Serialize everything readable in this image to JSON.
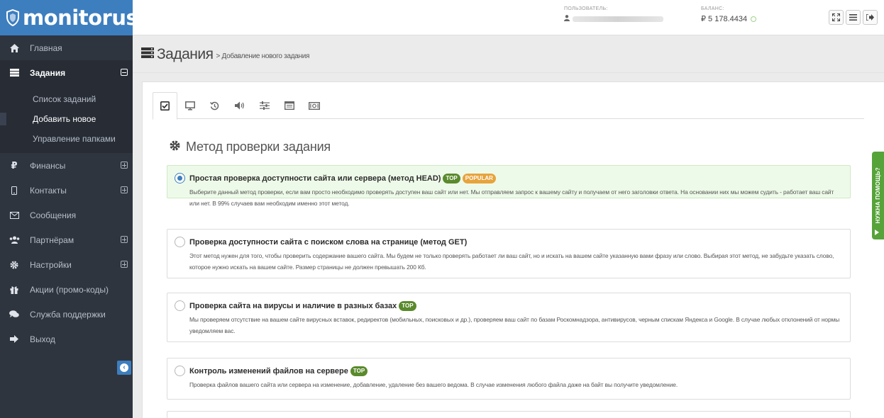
{
  "app": {
    "logo_text": "monitorus"
  },
  "sidebar": {
    "items": [
      {
        "label": "Главная",
        "icon": "home-icon"
      },
      {
        "label": "Задания",
        "icon": "tasks-icon"
      },
      {
        "label": "Финансы",
        "icon": "ruble-icon"
      },
      {
        "label": "Контакты",
        "icon": "phone-icon"
      },
      {
        "label": "Сообщения",
        "icon": "envelope-icon"
      },
      {
        "label": "Партнёрам",
        "icon": "users-icon"
      },
      {
        "label": "Настройки",
        "icon": "gear-icon"
      },
      {
        "label": "Акции (промо-коды)",
        "icon": "gift-icon"
      },
      {
        "label": "Служба поддержки",
        "icon": "comments-icon"
      },
      {
        "label": "Выход",
        "icon": "sign-out-icon"
      }
    ],
    "tasks_sub": [
      {
        "label": "Список заданий"
      },
      {
        "label": "Добавить новое"
      },
      {
        "label": "Управление папками"
      }
    ]
  },
  "header": {
    "user_label": "ПОЛЬЗОВАТЕЛЬ:",
    "balance_label": "БАЛАНС:",
    "balance_value": "₽ 5 178.4434"
  },
  "page": {
    "title": "Задания",
    "breadcrumb": "> Добавление нового задания"
  },
  "tabs": [
    {
      "icon": "check-square-icon"
    },
    {
      "icon": "monitor-icon"
    },
    {
      "icon": "history-icon"
    },
    {
      "icon": "volume-icon"
    },
    {
      "icon": "sliders-icon"
    },
    {
      "icon": "window-icon"
    },
    {
      "icon": "money-icon"
    }
  ],
  "section": {
    "title": "Метод проверки задания"
  },
  "options": [
    {
      "title": "Простая проверка доступности сайта или сервера (метод HEAD)",
      "badges": [
        "TOP",
        "POPULAR"
      ],
      "desc": "Выберите данный метод проверки, если вам просто необходимо проверять доступен ваш сайт или нет. Мы отправляем запрос к вашему сайту и получаем от него заголовки ответа. На основании них мы можем судить - работает ваш сайт или нет. В 99% случаев вам необходим именно этот метод.",
      "selected": true
    },
    {
      "title": "Проверка доступности сайта с поиском слова на странице (метод GET)",
      "badges": [],
      "desc": "Этот метод нужен для того, чтобы проверить содержание вашего сайта. Мы будем не только проверять работает ли ваш сайт, но и искать на вашем сайте указанную вами фразу или слово. Выбирая этот метод, не забудьте указать слово, которое нужно искать на вашем сайте. Размер страницы не должен превышать 200 Кб.",
      "selected": false
    },
    {
      "title": "Проверка сайта на вирусы и наличие в разных базах",
      "badges": [
        "TOP"
      ],
      "desc": "Мы проверяем отсутствие на вашем сайте вирусных вставок, редиректов (мобильных, поисковых и др.), проверяем ваш сайт по базам Роскомнадзора, антивирусов, черным спискам Яндекса и Google. В случае любых отклонений от нормы уведомляем вас.",
      "selected": false
    },
    {
      "title": "Контроль изменений файлов на сервере",
      "badges": [
        "TOP"
      ],
      "desc": "Проверка файлов вашего сайта или сервера на изменение, добавление, удаление без вашего ведома. В случае изменения любого файла даже на байт вы получите уведомление.",
      "selected": false
    }
  ],
  "help": {
    "label": "НУЖНА ПОМОЩЬ?"
  },
  "colors": {
    "brand": "#3d7ebf",
    "sidebar": "#2f353f",
    "selected_bg": "#eefae9",
    "top_badge": "#5a8a2c",
    "popular_badge": "#e7a33c",
    "help": "#56a33a"
  }
}
